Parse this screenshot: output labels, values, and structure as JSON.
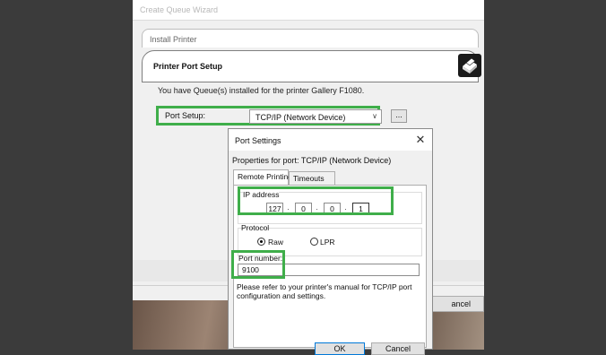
{
  "wizard": {
    "title": "Create Queue Wizard",
    "install_label": "Install Printer",
    "port_setup_header": "Printer Port Setup",
    "printer_icon": "printer-icon",
    "info_text": "You have Queue(s) installed for the printer Gallery F1080.",
    "port_setup_label": "Port Setup:",
    "port_select_value": "TCP/IP (Network Device)",
    "more_button": "...",
    "cancel_partial": "ancel"
  },
  "dialog": {
    "title": "Port Settings",
    "close": "✕",
    "properties_text": "Properties for port: TCP/IP (Network Device)",
    "tabs": [
      {
        "label": "Remote Printing",
        "active": true
      },
      {
        "label": "Timeouts",
        "active": false
      }
    ],
    "ip_label": "IP address",
    "ip_octets": [
      "127",
      "0",
      "0",
      "1"
    ],
    "protocol_label": "Protocol",
    "protocol_options": [
      {
        "label": "Raw",
        "selected": true
      },
      {
        "label": "LPR",
        "selected": false
      }
    ],
    "port_number_label": "Port number:",
    "port_number_value": "9100",
    "refer_text": "Please refer to your printer's manual for TCP/IP port configuration and settings.",
    "ok_label": "OK",
    "cancel_label": "Cancel"
  },
  "colors": {
    "highlight": "#3fae4a",
    "background": "#3b3b3b"
  }
}
